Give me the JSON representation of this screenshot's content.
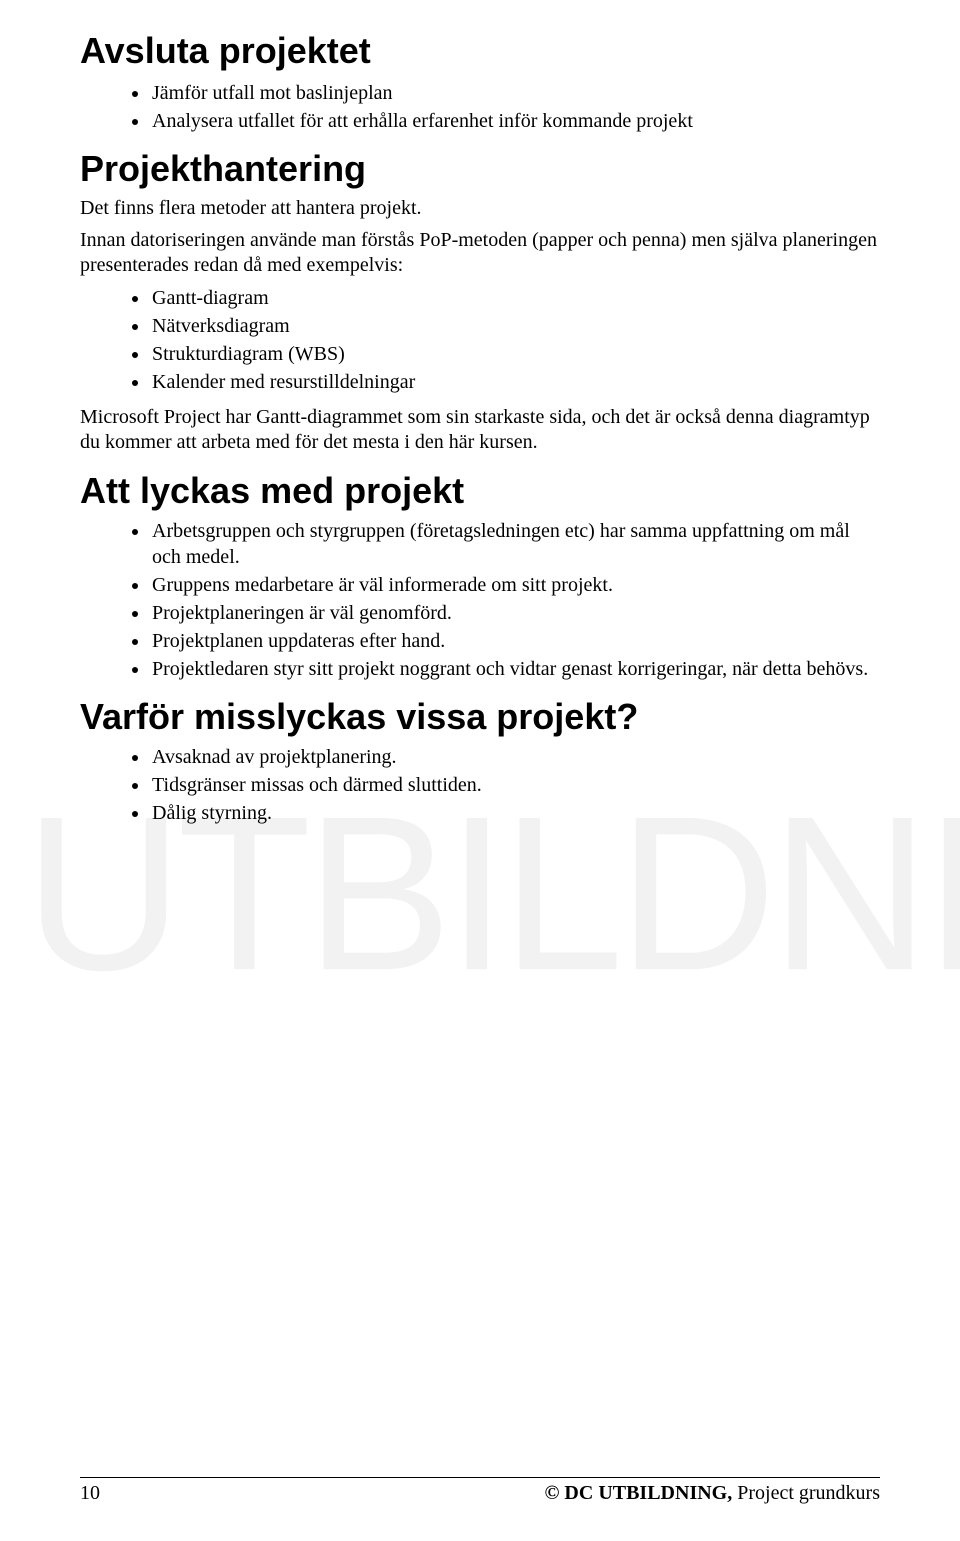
{
  "watermark": "DC UTBILDNING",
  "sections": {
    "s1": {
      "heading": "Avsluta projektet",
      "items": [
        "Jämför utfall mot baslinjeplan",
        "Analysera utfallet för att erhålla erfarenhet inför kommande projekt"
      ]
    },
    "s2": {
      "heading": "Projekthantering",
      "intro1": "Det finns flera metoder att hantera projekt.",
      "intro2": "Innan datoriseringen använde man förstås PoP-metoden (papper och penna) men själva planeringen presenterades redan då med exempelvis:",
      "items2": [
        "Gantt-diagram",
        "Nätverksdiagram",
        "Strukturdiagram (WBS)",
        "Kalender med resurstilldelningar"
      ],
      "outro": "Microsoft Project har Gantt-diagrammet som sin starkaste sida, och det är också denna diagramtyp du kommer att arbeta med för det mesta i den här kursen."
    },
    "s3": {
      "heading": "Att lyckas med projekt",
      "items": [
        "Arbetsgruppen och styrgruppen (företagsledningen etc) har samma uppfattning om mål och medel.",
        "Gruppens medarbetare är väl informerade om sitt projekt.",
        "Projektplaneringen är väl genomförd.",
        "Projektplanen uppdateras efter hand.",
        "Projektledaren styr sitt projekt noggrant och vidtar genast korrigeringar, när detta behövs."
      ]
    },
    "s4": {
      "heading": "Varför misslyckas vissa projekt?",
      "items": [
        "Avsaknad av projektplanering.",
        "Tidsgränser missas och därmed sluttiden.",
        "Dålig styrning."
      ]
    }
  },
  "footer": {
    "page": "10",
    "copyright_bold": "© DC UTBILDNING,",
    "copyright_rest": " Project grundkurs"
  }
}
